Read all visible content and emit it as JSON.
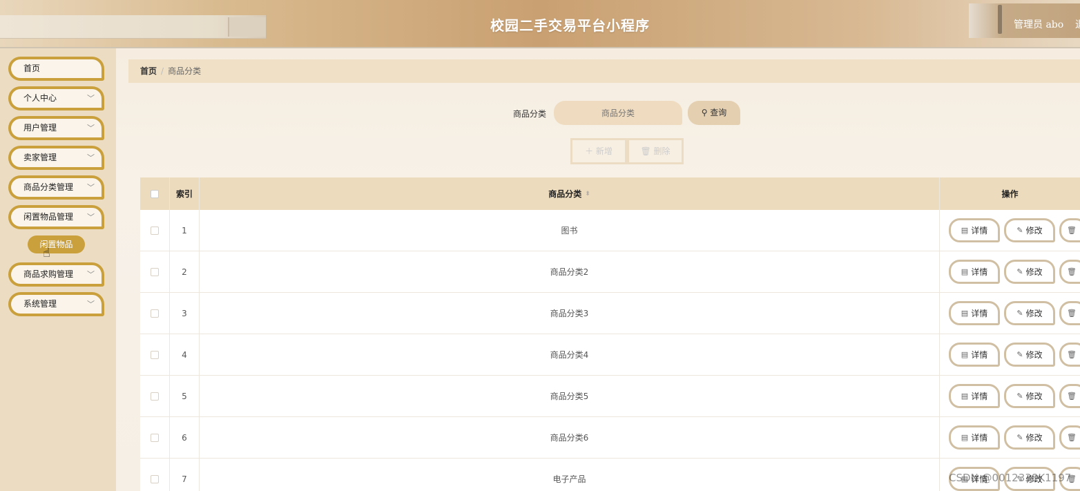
{
  "header": {
    "title": "校园二手交易平台小程序",
    "admin": "管理员 abo",
    "admin_extra": "退"
  },
  "sidebar": {
    "items": [
      {
        "label": "首页",
        "has_chevron": false
      },
      {
        "label": "个人中心",
        "has_chevron": true
      },
      {
        "label": "用户管理",
        "has_chevron": true
      },
      {
        "label": "卖家管理",
        "has_chevron": true
      },
      {
        "label": "商品分类管理",
        "has_chevron": true
      },
      {
        "label": "闲置物品管理",
        "has_chevron": true
      },
      {
        "label": "商品求购管理",
        "has_chevron": true
      },
      {
        "label": "系统管理",
        "has_chevron": true
      }
    ],
    "sub_item": "闲置物品"
  },
  "breadcrumb": {
    "home": "首页",
    "sep": "/",
    "current": "商品分类"
  },
  "search": {
    "label": "商品分类",
    "placeholder": "商品分类",
    "button": "查询"
  },
  "actions": {
    "add": "新增",
    "delete": "删除"
  },
  "table": {
    "headers": {
      "index": "索引",
      "name": "商品分类",
      "ops": "操作"
    },
    "rows": [
      {
        "index": "1",
        "name": "图书"
      },
      {
        "index": "2",
        "name": "商品分类2"
      },
      {
        "index": "3",
        "name": "商品分类3"
      },
      {
        "index": "4",
        "name": "商品分类4"
      },
      {
        "index": "5",
        "name": "商品分类5"
      },
      {
        "index": "6",
        "name": "商品分类6"
      },
      {
        "index": "7",
        "name": "电子产品"
      }
    ],
    "row_ops": {
      "detail": "详情",
      "edit": "修改"
    }
  },
  "watermark": "CSDN @0012338K1197",
  "colors": {
    "accent": "#caa03c",
    "header_bg": "#c9a071",
    "sidebar_bg": "#ecdcc2"
  },
  "icons": {
    "chevron": "chevron-down-icon",
    "search": "search-icon",
    "detail": "document-icon",
    "edit": "pencil-icon",
    "delete": "trash-icon",
    "add": "plus-icon",
    "sort": "sort-icon"
  }
}
